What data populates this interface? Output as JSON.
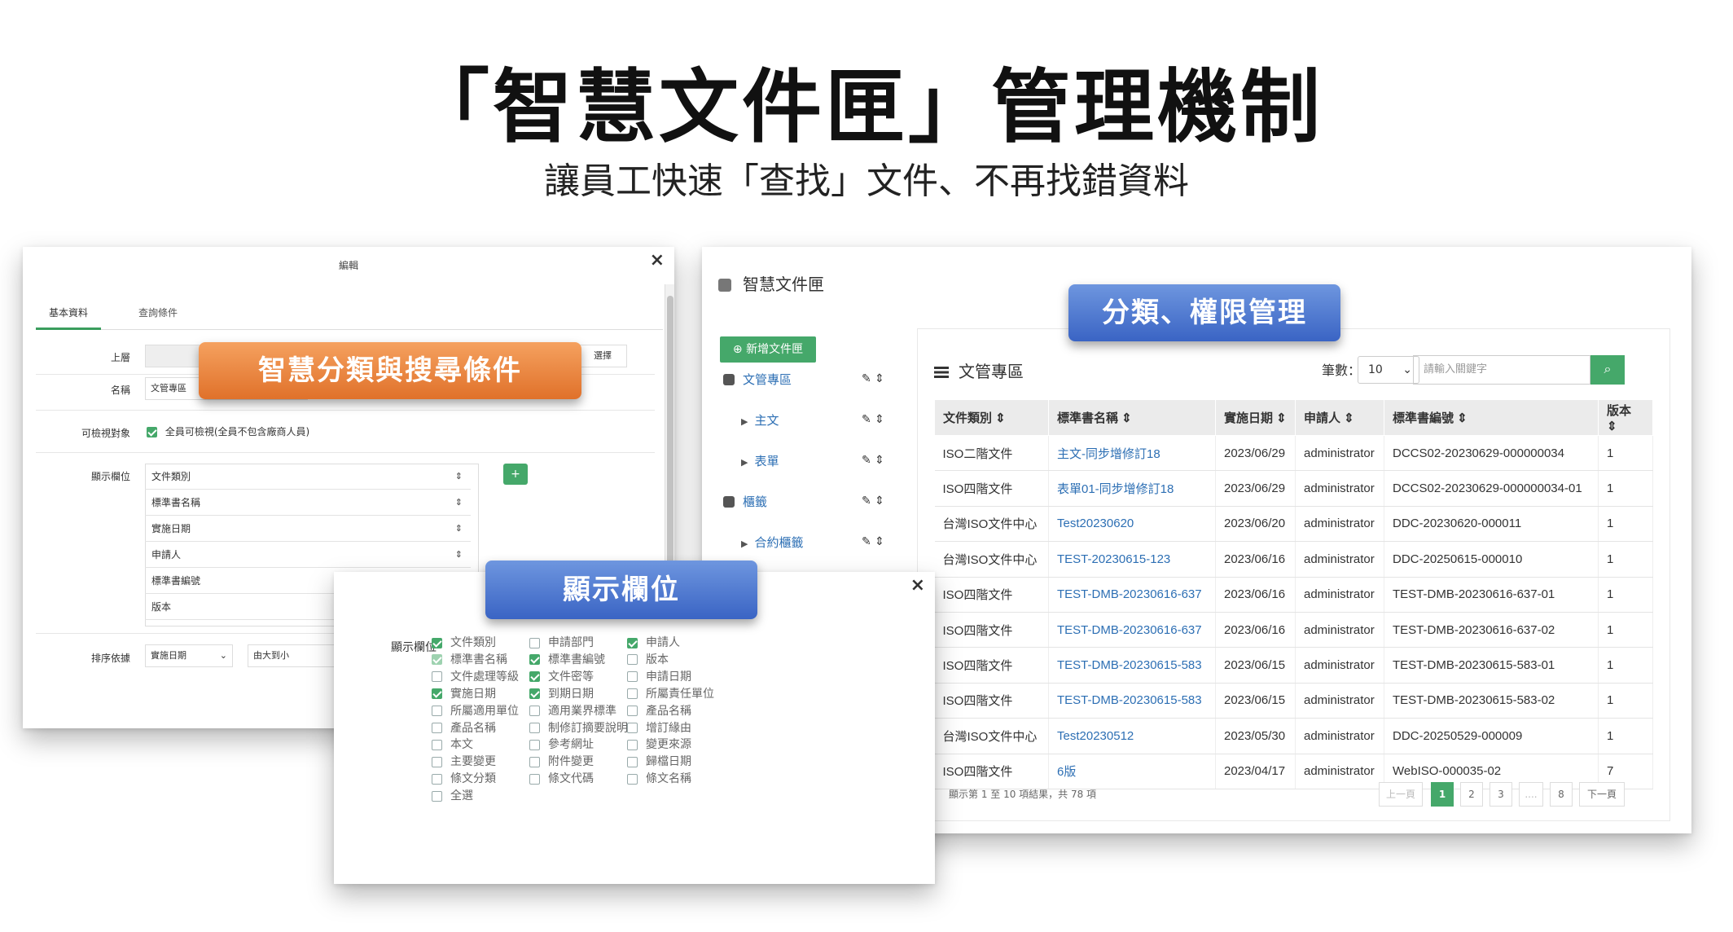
{
  "hero": {
    "title": "「智慧文件匣」管理機制",
    "subtitle": "讓員工快速「查找」文件、不再找錯資料"
  },
  "callouts": {
    "search": "智慧分類與搜尋條件",
    "permission": "分類、權限管理",
    "columns": "顯示欄位"
  },
  "editor": {
    "title": "編輯",
    "close": "×",
    "tabs": [
      "基本資料",
      "查詢條件"
    ],
    "labels": {
      "parent": "上層",
      "name": "名稱",
      "visible": "可檢視對象",
      "columns": "顯示欄位",
      "sort": "排序依據"
    },
    "parent_value": "",
    "parent_btn": "選擇",
    "name_value": "文管專區",
    "visible_option": "全員可檢視(全員不包含廠商人員)",
    "columns": [
      "文件類別",
      "標準書名稱",
      "實施日期",
      "申請人",
      "標準書編號",
      "版本"
    ],
    "sort_field": "實施日期",
    "sort_order": "由大到小",
    "add_btn": "+"
  },
  "library": {
    "title": "智慧文件匣",
    "new_btn": "新增文件匣",
    "tree": [
      {
        "label": "文管專區",
        "level": 0
      },
      {
        "label": "主文",
        "level": 1
      },
      {
        "label": "表單",
        "level": 1
      },
      {
        "label": "櫃籤",
        "level": 0
      },
      {
        "label": "合約櫃籤",
        "level": 1
      }
    ],
    "tree_tools": "✎ ⇕",
    "section_title": "文管專區",
    "count_label": "筆數：",
    "count_value": "10",
    "search_placeholder": "請輸入關鍵字",
    "search_icon": "search-icon",
    "headers": [
      "文件類別 ⇕",
      "標準書名稱 ⇕",
      "實施日期 ⇕",
      "申請人 ⇕",
      "標準書編號 ⇕",
      "版本 ⇕"
    ],
    "rows": [
      [
        "ISO二階文件",
        "主文-同步增修訂18",
        "2023/06/29",
        "administrator",
        "DCCS02-20230629-000000034",
        "1"
      ],
      [
        "ISO四階文件",
        "表單01-同步增修訂18",
        "2023/06/29",
        "administrator",
        "DCCS02-20230629-000000034-01",
        "1"
      ],
      [
        "台灣ISO文件中心",
        "Test20230620",
        "2023/06/20",
        "administrator",
        "DDC-20230620-000011",
        "1"
      ],
      [
        "台灣ISO文件中心",
        "TEST-20230615-123",
        "2023/06/16",
        "administrator",
        "DDC-20250615-000010",
        "1"
      ],
      [
        "ISO四階文件",
        "TEST-DMB-20230616-637",
        "2023/06/16",
        "administrator",
        "TEST-DMB-20230616-637-01",
        "1"
      ],
      [
        "ISO四階文件",
        "TEST-DMB-20230616-637",
        "2023/06/16",
        "administrator",
        "TEST-DMB-20230616-637-02",
        "1"
      ],
      [
        "ISO四階文件",
        "TEST-DMB-20230615-583",
        "2023/06/15",
        "administrator",
        "TEST-DMB-20230615-583-01",
        "1"
      ],
      [
        "ISO四階文件",
        "TEST-DMB-20230615-583",
        "2023/06/15",
        "administrator",
        "TEST-DMB-20230615-583-02",
        "1"
      ],
      [
        "台灣ISO文件中心",
        "Test20230512",
        "2023/05/30",
        "administrator",
        "DDC-20250529-000009",
        "1"
      ],
      [
        "ISO四階文件",
        "6版",
        "2023/04/17",
        "administrator",
        "WebISO-000035-02",
        "7"
      ]
    ],
    "footer": "顯示第 1 至 10 項結果，共 78 項",
    "pager": [
      "上一頁",
      "1",
      "2",
      "3",
      "....",
      "8",
      "下一頁"
    ]
  },
  "picker": {
    "label": "顯示欄位",
    "close": "×",
    "options": [
      [
        {
          "t": "文件類別",
          "s": "on"
        },
        {
          "t": "申請部門",
          "s": "off"
        },
        {
          "t": "申請人",
          "s": "on"
        }
      ],
      [
        {
          "t": "標準書名稱",
          "s": "lite"
        },
        {
          "t": "標準書編號",
          "s": "on"
        },
        {
          "t": "版本",
          "s": "off"
        }
      ],
      [
        {
          "t": "文件處理等級",
          "s": "off"
        },
        {
          "t": "文件密等",
          "s": "on"
        },
        {
          "t": "申請日期",
          "s": "off"
        }
      ],
      [
        {
          "t": "實施日期",
          "s": "on"
        },
        {
          "t": "到期日期",
          "s": "on"
        },
        {
          "t": "所屬責任單位",
          "s": "off"
        }
      ],
      [
        {
          "t": "所屬適用單位",
          "s": "off"
        },
        {
          "t": "適用業界標準",
          "s": "off"
        },
        {
          "t": "產品名稱",
          "s": "off"
        }
      ],
      [
        {
          "t": "產品名稱",
          "s": "off"
        },
        {
          "t": "制修訂摘要說明",
          "s": "off"
        },
        {
          "t": "增訂緣由",
          "s": "off"
        }
      ],
      [
        {
          "t": "本文",
          "s": "off"
        },
        {
          "t": "參考網址",
          "s": "off"
        },
        {
          "t": "變更來源",
          "s": "off"
        }
      ],
      [
        {
          "t": "主要變更",
          "s": "off"
        },
        {
          "t": "附件變更",
          "s": "off"
        },
        {
          "t": "歸檔日期",
          "s": "off"
        }
      ],
      [
        {
          "t": "條文分類",
          "s": "off"
        },
        {
          "t": "條文代碼",
          "s": "off"
        },
        {
          "t": "條文名稱",
          "s": "off"
        }
      ],
      [
        {
          "t": "全選",
          "s": "off"
        }
      ]
    ]
  },
  "colors": {
    "accent_green": "#45a86a",
    "link_blue": "#2d6fb4",
    "callout_orange": "#e0712a",
    "callout_blue": "#3a64c4"
  }
}
